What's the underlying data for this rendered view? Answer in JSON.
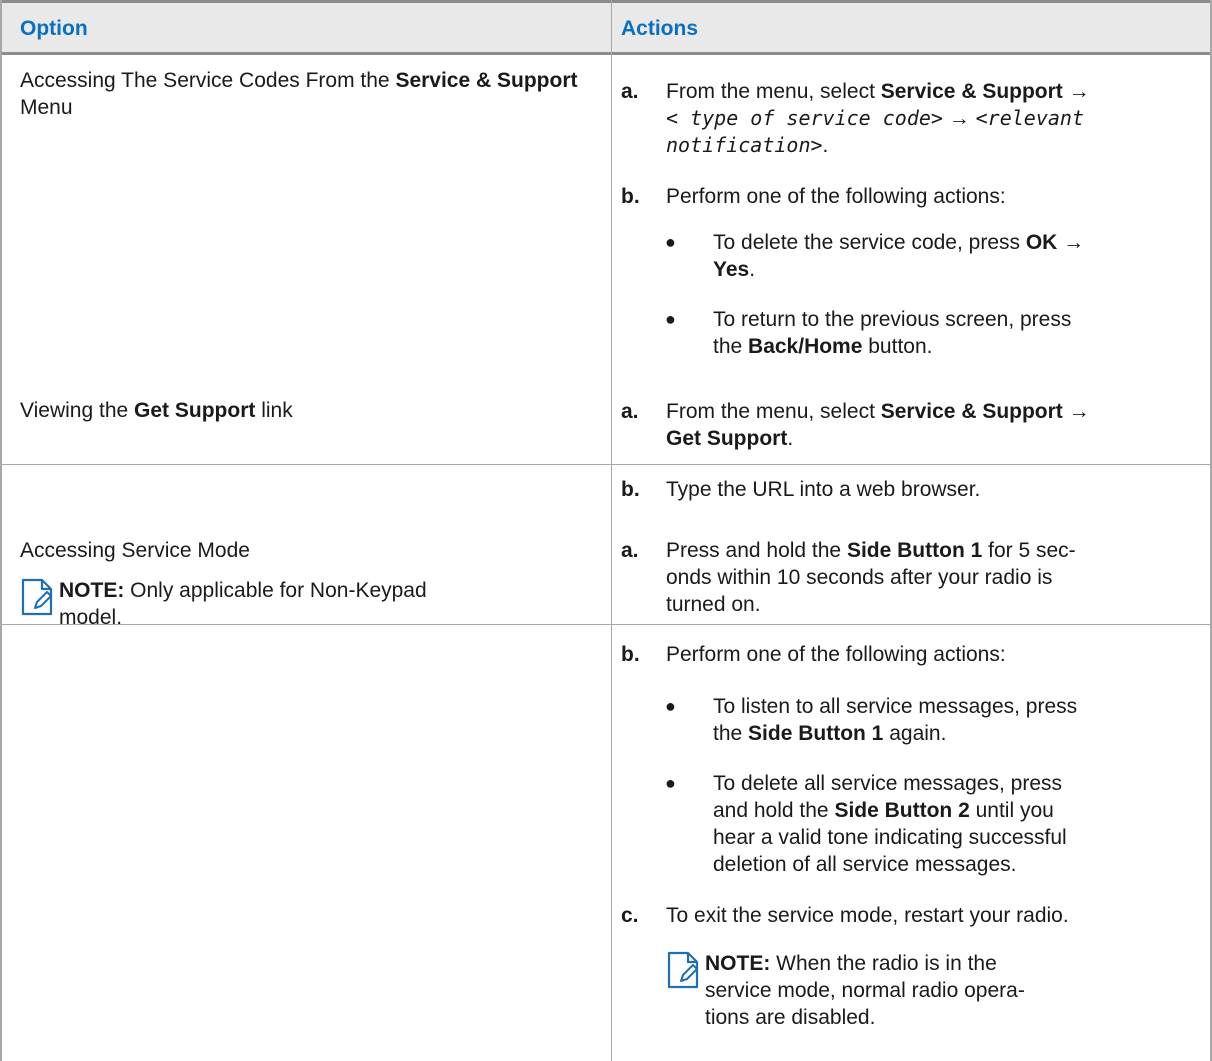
{
  "header": {
    "option": "Option",
    "actions": "Actions"
  },
  "rows": [
    {
      "option": {
        "prefix": "Accessing The Service Codes From the ",
        "bold": "Service & Support",
        "suffix": " Menu"
      },
      "steps": [
        {
          "letter": "a.",
          "t1": "From the menu, select ",
          "b1": "Service & Support",
          "arrow1": " →",
          "mono1": "< type of service code>",
          "arrow2": " → ",
          "mono2": "<relevant",
          "mono3": "notification>",
          "end": "."
        },
        {
          "letter": "b.",
          "text": "Perform one of the following actions:"
        }
      ],
      "bullets": [
        {
          "t1": "To delete the service code, press ",
          "b1": "OK",
          "t2": " →",
          "b2": "Yes",
          "t3": "."
        },
        {
          "t1": "To return to the previous screen, press",
          "t2": "the ",
          "b1": "Back/Home",
          "t3": " button."
        }
      ]
    },
    {
      "option": {
        "prefix": "Viewing the ",
        "bold": "Get Support",
        "suffix": " link"
      },
      "steps": [
        {
          "letter": "a.",
          "t1": "From the menu, select ",
          "b1": "Service & Support",
          "t2": " →",
          "b2": "Get Support",
          "end": "."
        },
        {
          "letter": "b.",
          "text": "Type the URL into a web browser."
        }
      ]
    },
    {
      "option": {
        "title": "Accessing Service Mode",
        "note_label": "NOTE:",
        "note_text_1": " Only applicable for Non-Keypad",
        "note_text_2": "model."
      },
      "steps": [
        {
          "letter": "a.",
          "t1": "Press and hold the ",
          "b1": "Side Button 1",
          "t2": " for 5 sec-",
          "line2": "onds within 10 seconds after your radio is",
          "line3": "turned on."
        },
        {
          "letter": "b.",
          "text": "Perform one of the following actions:"
        },
        {
          "letter": "c.",
          "text": "To exit the service mode, restart your radio."
        }
      ],
      "bullets": [
        {
          "t1": "To listen to all service messages, press",
          "t2": "the ",
          "b1": "Side Button 1",
          "t3": " again."
        },
        {
          "t1": "To delete all service messages, press",
          "t2": "and hold the ",
          "b1": "Side Button 2",
          "t3": " until you",
          "line3": "hear a valid tone indicating successful",
          "line4": "deletion of all service messages."
        }
      ],
      "note": {
        "label": "NOTE:",
        "line1": " When the radio is in the",
        "line2": "service mode, normal radio opera-",
        "line3": "tions are disabled."
      }
    }
  ],
  "colors": {
    "header_text": "#0a6fc2",
    "header_bg": "#e9e9e9",
    "note_icon": "#1f6fb5"
  }
}
